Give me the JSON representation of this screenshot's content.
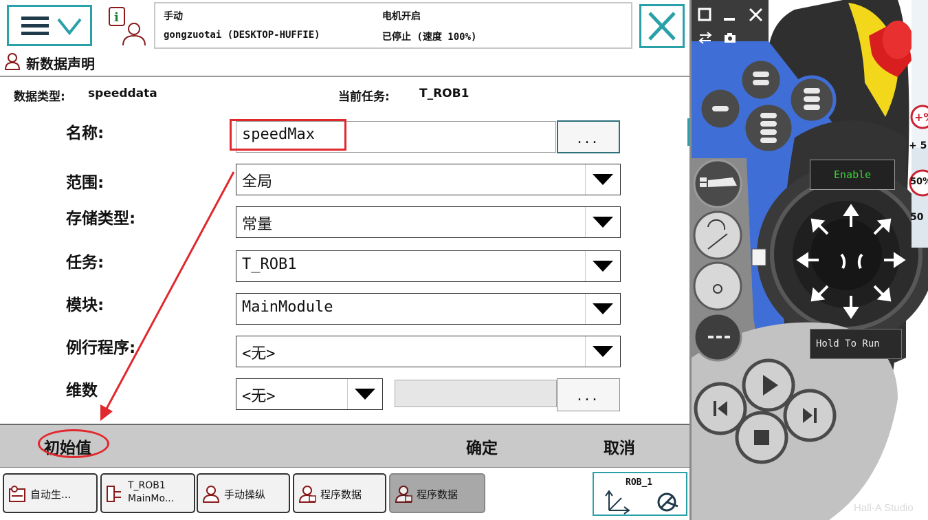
{
  "header": {
    "mode_label": "手动",
    "station_label": "gongzuotai (DESKTOP-HUFFIE)",
    "motor_label": "电机开启",
    "state_label": "已停止 (速度 100%)"
  },
  "page": {
    "title": "新数据声明",
    "data_type_label": "数据类型:",
    "data_type_value": "speeddata",
    "current_task_label": "当前任务:",
    "current_task_value": "T_ROB1"
  },
  "form": {
    "name_label": "名称:",
    "name_value": "speedMax",
    "name_button": "...",
    "scope_label": "范围:",
    "scope_value": "全局",
    "storage_label": "存储类型:",
    "storage_value": "常量",
    "task_label": "任务:",
    "task_value": "T_ROB1",
    "module_label": "模块:",
    "module_value": "MainModule",
    "routine_label": "例行程序:",
    "routine_value": "<无>",
    "dims_label": "维数",
    "dims_value": "<无>",
    "dims_button": "..."
  },
  "actions": {
    "initial": "初始值",
    "ok": "确定",
    "cancel": "取消"
  },
  "taskbar": {
    "items": [
      {
        "label": "自动生..."
      },
      {
        "label": "T_ROB1",
        "label2": "MainMo..."
      },
      {
        "label": "手动操纵"
      },
      {
        "label": "程序数据"
      },
      {
        "label": "程序数据"
      }
    ],
    "rob_label": "ROB_1"
  },
  "pendant": {
    "enable_label": "Enable",
    "hold_label": "Hold To Run",
    "plus5": "+ 5",
    "fifty": "50",
    "fifty_pct": "50%"
  },
  "watermark": "Hall-A Studio",
  "colors": {
    "accent_teal": "#2aa0a8",
    "annotation_red": "#e0282e",
    "pendant_blue": "#3f6fd6",
    "action_bar_gray": "#c9c9c9"
  }
}
